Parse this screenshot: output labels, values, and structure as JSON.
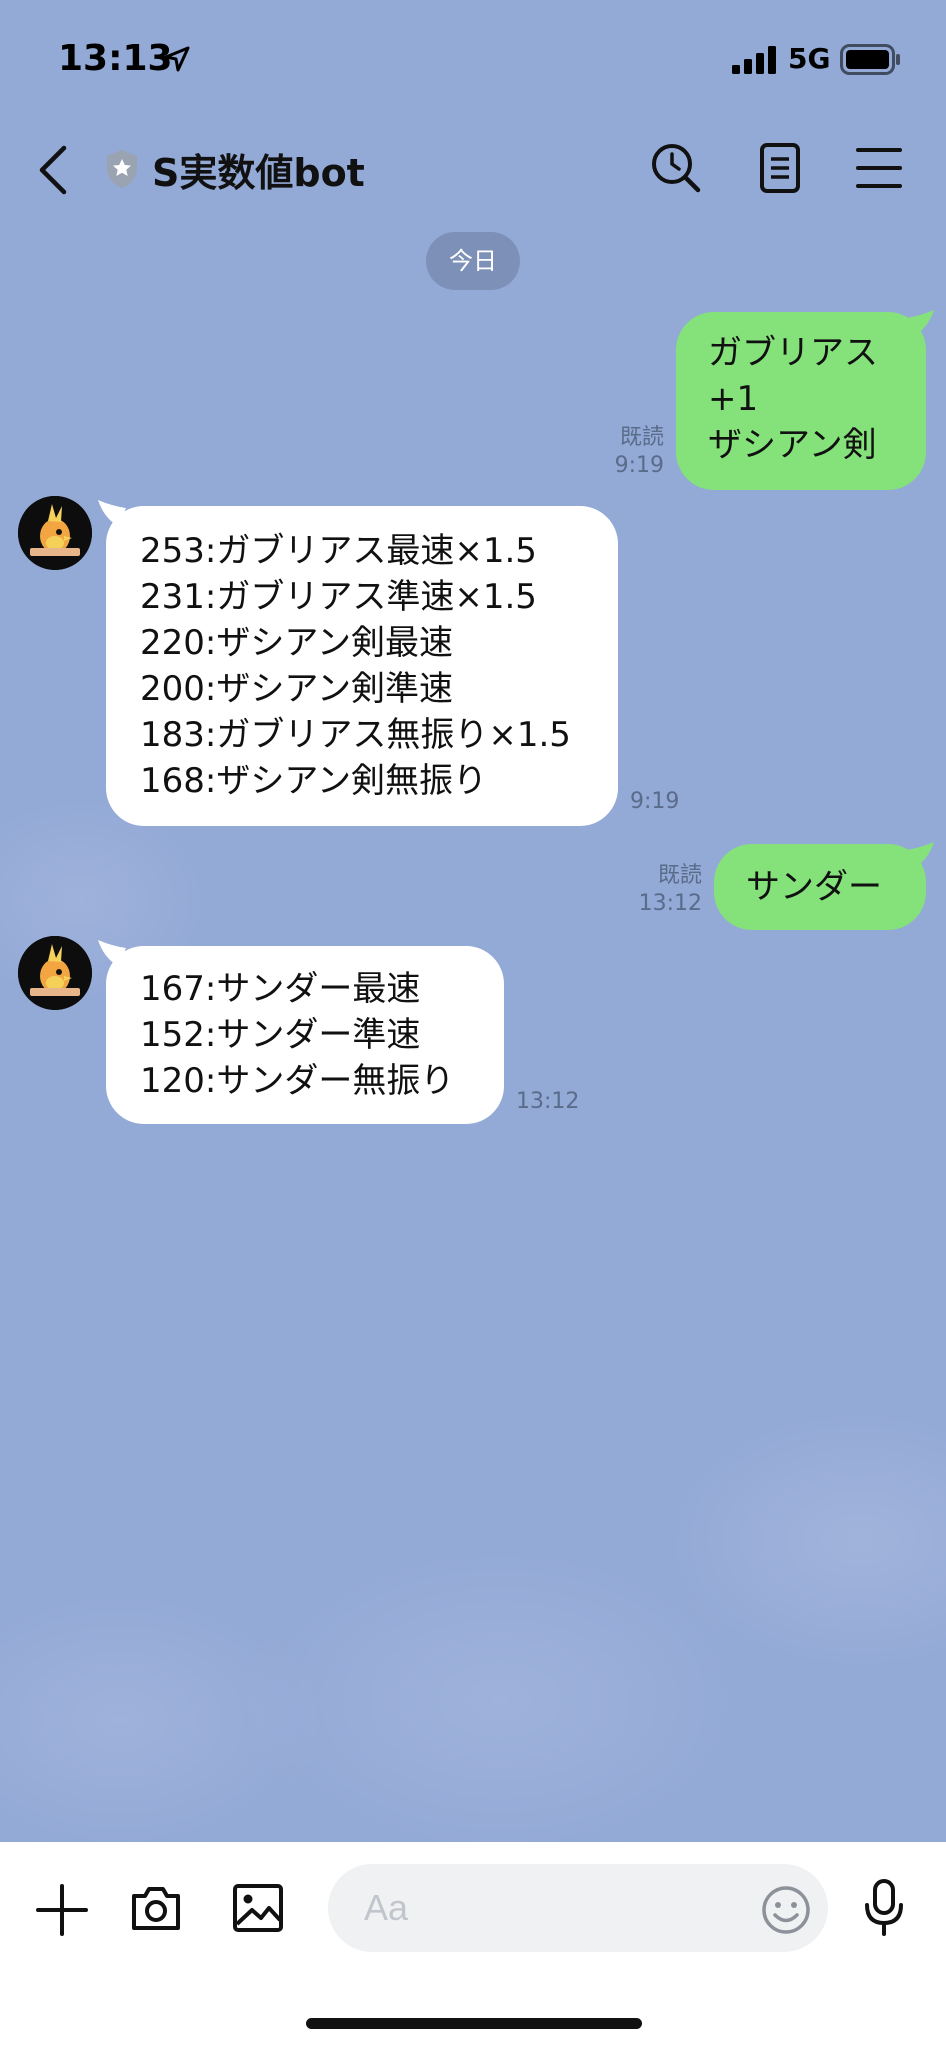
{
  "status_bar": {
    "time": "13:13",
    "network": "5G"
  },
  "header": {
    "title": "S実数値bot"
  },
  "date_chip": "今日",
  "messages": [
    {
      "direction": "out",
      "lines": [
        "ガブリアス",
        "+1",
        "ザシアン剣"
      ],
      "read": "既読",
      "time": "9:19"
    },
    {
      "direction": "in",
      "lines": [
        "253:ガブリアス最速×1.5",
        "231:ガブリアス準速×1.5",
        "220:ザシアン剣最速",
        "200:ザシアン剣準速",
        "183:ガブリアス無振り×1.5",
        "168:ザシアン剣無振り"
      ],
      "time": "9:19"
    },
    {
      "direction": "out",
      "lines": [
        "サンダー"
      ],
      "read": "既読",
      "time": "13:12"
    },
    {
      "direction": "in",
      "lines": [
        "167:サンダー最速",
        "152:サンダー準速",
        "120:サンダー無振り"
      ],
      "time": "13:12"
    }
  ],
  "input": {
    "placeholder": "Aa"
  },
  "colors": {
    "background": "#93a9d6",
    "outgoing_bubble": "#85e27b",
    "incoming_bubble": "#ffffff"
  },
  "icons": [
    "location-arrow-icon",
    "signal-icon",
    "battery-icon",
    "back-icon",
    "shield-icon",
    "search-icon",
    "notes-icon",
    "menu-icon",
    "plus-icon",
    "camera-icon",
    "image-icon",
    "emoji-icon",
    "mic-icon"
  ]
}
